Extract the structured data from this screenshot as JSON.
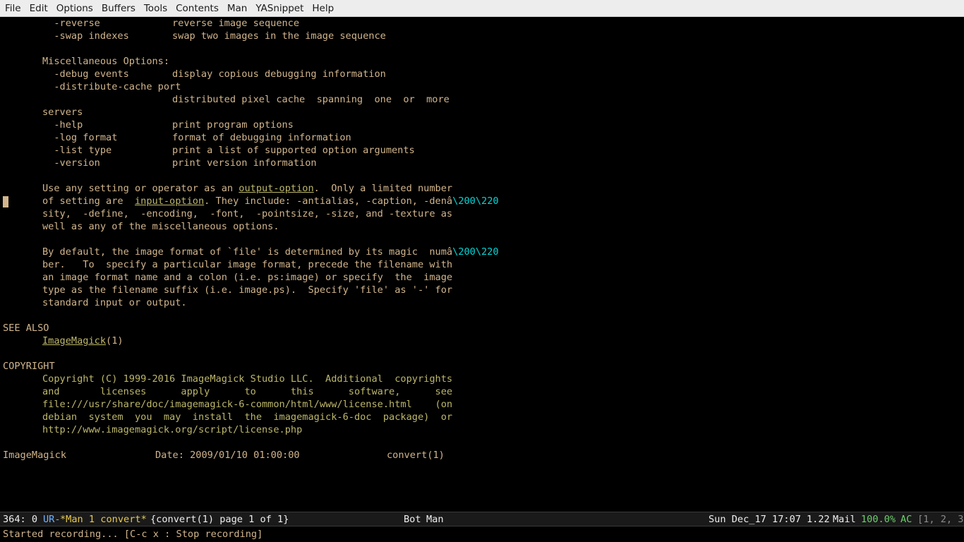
{
  "menubar": {
    "items": [
      "File",
      "Edit",
      "Options",
      "Buffers",
      "Tools",
      "Contents",
      "Man",
      "YASnippet",
      "Help"
    ]
  },
  "man": {
    "reverse_opt": "  -reverse",
    "reverse_desc": "reverse image sequence",
    "swap_opt": "  -swap indexes",
    "swap_desc": "swap two images in the image sequence",
    "misc_heading": "Miscellaneous Options:",
    "debug_opt": "  -debug events",
    "debug_desc": "display copious debugging information",
    "distribute_opt": "  -distribute-cache port",
    "distribute_desc": "distributed pixel cache  spanning  one  or  more",
    "servers": "servers",
    "help_opt": "  -help",
    "help_desc": "print program options",
    "log_opt": "  -log format",
    "log_desc": "format of debugging information",
    "list_opt": "  -list type",
    "list_desc": "print a list of supported option arguments",
    "version_opt": "  -version",
    "version_desc": "print version information",
    "p1_l1a": "Use any setting or operator as an ",
    "p1_l1_link": "output-option",
    "p1_l1b": ".  Only a limited number",
    "p1_l2a": "of setting are  ",
    "p1_l2_link": "input-option",
    "p1_l2b": ". They include: -antialias, -caption, -denâ",
    "p1_l2_esc": "\\200\\220",
    "p1_l3": "sity,  -define,  -encoding,  -font,  -pointsize, -size, and -texture as",
    "p1_l4": "well as any of the miscellaneous options.",
    "p2_l1a": "By default, the image format of `file' is determined by its magic  numâ",
    "p2_l1_esc": "\\200\\220",
    "p2_l2": "ber.   To  specify a particular image format, precede the filename with",
    "p2_l3": "an image format name and a colon (i.e. ps:image) or specify  the  image",
    "p2_l4": "type as the filename suffix (i.e. image.ps).  Specify 'file' as '-' for",
    "p2_l5": "standard input or output.",
    "see_also_heading": "SEE ALSO",
    "see_also_link": "ImageMagick",
    "see_also_suffix": "(1)",
    "copyright_heading": "COPYRIGHT",
    "c_l1": "Copyright (C) 1999-2016 ImageMagick Studio LLC.  Additional  copyrights",
    "c_l2": "and       licenses      apply      to      this      software,      see",
    "c_l3": "file:///usr/share/doc/imagemagick-6-common/html/www/license.html    (on",
    "c_l4": "debian  system  you  may  install  the  imagemagick-6-doc  package)  or",
    "c_l5": "http://www.imagemagick.org/script/license.php",
    "footer_left": "ImageMagick",
    "footer_mid": "Date: 2009/01/10 01:00:00",
    "footer_right": "convert(1)"
  },
  "modeline": {
    "position": "364: 0",
    "flags": "UR-",
    "buffer": "*Man 1 convert*",
    "page": "{convert(1) page 1 of 1}",
    "bot": "Bot",
    "mode": "Man",
    "icon": "no-eye-icon",
    "datetime": "Sun Dec_17 17:07",
    "load": "1.22",
    "mail": "Mail",
    "battery": "100.0%",
    "ac": "AC",
    "extra": "[1, 2, 3"
  },
  "echo_area": {
    "text": "Started recording... [C-c x : Stop recording]"
  }
}
